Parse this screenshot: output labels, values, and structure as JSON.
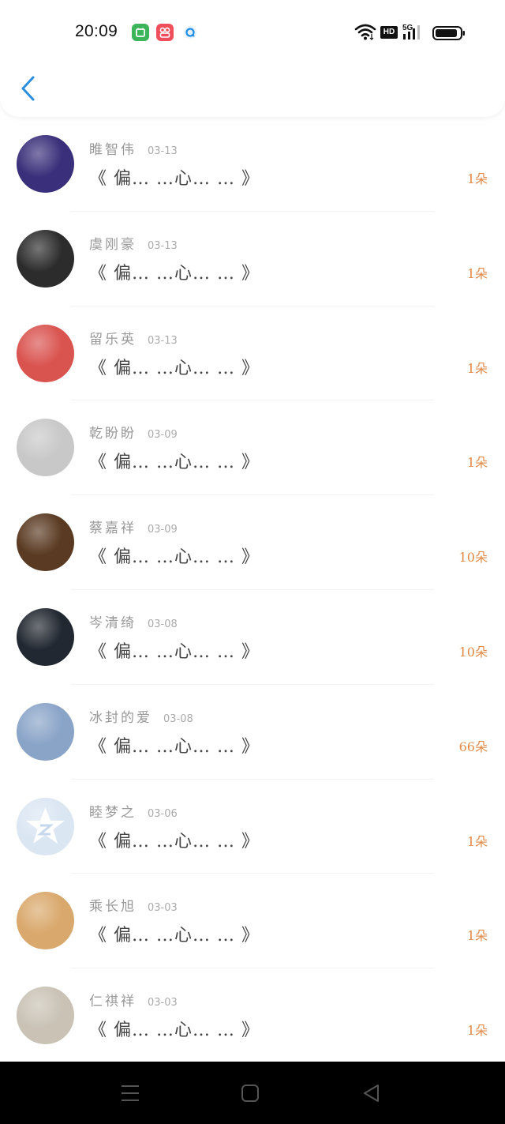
{
  "status_bar": {
    "time": "20:09",
    "network_badge": "HD",
    "network_type": "5G"
  },
  "header": {
    "back_icon": "chevron-left-icon",
    "accent_color": "#2b8ee0"
  },
  "items": [
    {
      "name": "睢智伟",
      "date": "03-13",
      "title": "《 偏… …心… … 》",
      "count": "1朵",
      "avatar_color": "#3a2f7a"
    },
    {
      "name": "虞刚豪",
      "date": "03-13",
      "title": "《 偏… …心… … 》",
      "count": "1朵",
      "avatar_color": "#2c2c2c"
    },
    {
      "name": "留乐英",
      "date": "03-13",
      "title": "《 偏… …心… … 》",
      "count": "1朵",
      "avatar_color": "#d9534f"
    },
    {
      "name": "乾盼盼",
      "date": "03-09",
      "title": "《 偏… …心… … 》",
      "count": "1朵",
      "avatar_color": "#c8c8c8"
    },
    {
      "name": "蔡嘉祥",
      "date": "03-09",
      "title": "《 偏… …心… … 》",
      "count": "10朵",
      "avatar_color": "#5a3a22"
    },
    {
      "name": "岑清绮",
      "date": "03-08",
      "title": "《 偏… …心… … 》",
      "count": "10朵",
      "avatar_color": "#222831"
    },
    {
      "name": "冰封的爱",
      "date": "03-08",
      "title": "《 偏… …心… … 》",
      "count": "66朵",
      "avatar_color": "#8aa4c8"
    },
    {
      "name": "睦梦之",
      "date": "03-06",
      "title": "《 偏… …心… … 》",
      "count": "1朵",
      "avatar_color": "#dbe6f3"
    },
    {
      "name": "乘长旭",
      "date": "03-03",
      "title": "《 偏… …心… … 》",
      "count": "1朵",
      "avatar_color": "#d9a86c"
    },
    {
      "name": "仁祺祥",
      "date": "03-03",
      "title": "《 偏… …心… … 》",
      "count": "1朵",
      "avatar_color": "#c9c2b5"
    }
  ],
  "count_color": "#e48a48",
  "nav": {
    "menu_icon": "menu-icon",
    "home_icon": "home-square-icon",
    "back_icon": "back-triangle-icon"
  }
}
